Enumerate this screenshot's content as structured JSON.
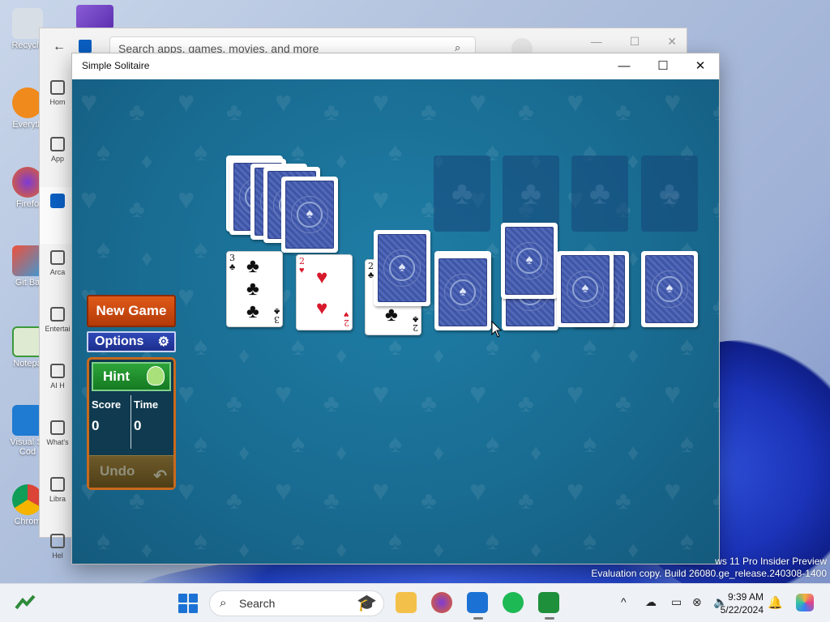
{
  "desktop": {
    "icons": [
      {
        "label": "Recycle",
        "color": "#cfd6df"
      },
      {
        "label": "Everyth",
        "color": "#f08a1c"
      },
      {
        "label": "Firefo",
        "color": "#e8631c"
      },
      {
        "label": "Git Ba",
        "color": "#f0503c"
      },
      {
        "label": "Notepa",
        "color": "#3a9a3a"
      },
      {
        "label": "Visual St\nCod",
        "color": "#1f7ad1"
      },
      {
        "label": "Chrom",
        "color": "#3c8ce7"
      }
    ],
    "watermark_line1": "ws 11 Pro Insider Preview",
    "watermark_line2": "Evaluation copy. Build 26080.ge_release.240308-1400"
  },
  "store": {
    "search_placeholder": "Search apps, games, movies, and more",
    "nav": [
      "Hom",
      "App",
      "",
      "Arca",
      "Entertai",
      "AI H",
      "What's",
      "Libra",
      "Hel"
    ]
  },
  "solitaire": {
    "title": "Simple Solitaire",
    "buttons": {
      "new_game": "New Game",
      "options": "Options",
      "hint": "Hint",
      "undo": "Undo"
    },
    "score_label": "Score",
    "time_label": "Time",
    "score": "0",
    "time": "0",
    "waste": [
      {
        "rank": "3",
        "suit": "♣",
        "color": "blk"
      },
      {
        "rank": "2",
        "suit": "♥",
        "color": "red"
      },
      {
        "rank": "2",
        "suit": "♣",
        "color": "blk"
      }
    ]
  },
  "taskbar": {
    "search_label": "Search",
    "time": "9:39 AM",
    "date": "5/22/2024"
  },
  "colors": {
    "felt": "#196c92",
    "new_game": "#d44a12",
    "options": "#273fa6",
    "hint": "#22912e",
    "undo": "#5e4c20",
    "panel_border": "#c9691c"
  }
}
